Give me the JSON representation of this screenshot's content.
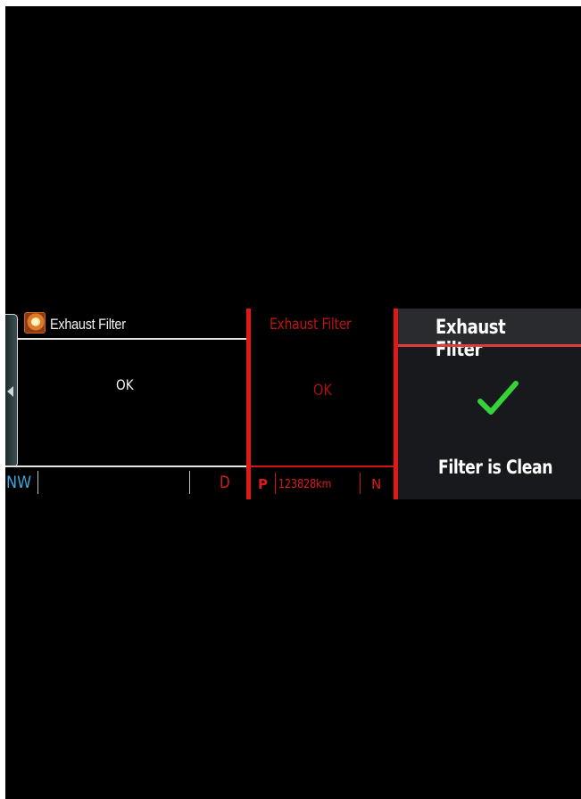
{
  "panel_classic": {
    "title": "Exhaust Filter",
    "status": "OK",
    "compass": "NW",
    "gear": "D",
    "icon": "exhaust-filter-warning-icon"
  },
  "panel_red": {
    "title": "Exhaust Filter",
    "status": "OK",
    "gear_left": "P",
    "odometer": "123828km",
    "gear_right": "N"
  },
  "panel_modern": {
    "title": "Exhaust Filter",
    "message": "Filter is Clean",
    "icon": "checkmark-icon"
  },
  "colors": {
    "background": "#000000",
    "divider": "#e01818",
    "accent": "#e23a3a",
    "compass": "#3ba6e0",
    "check": "#36d23a"
  }
}
